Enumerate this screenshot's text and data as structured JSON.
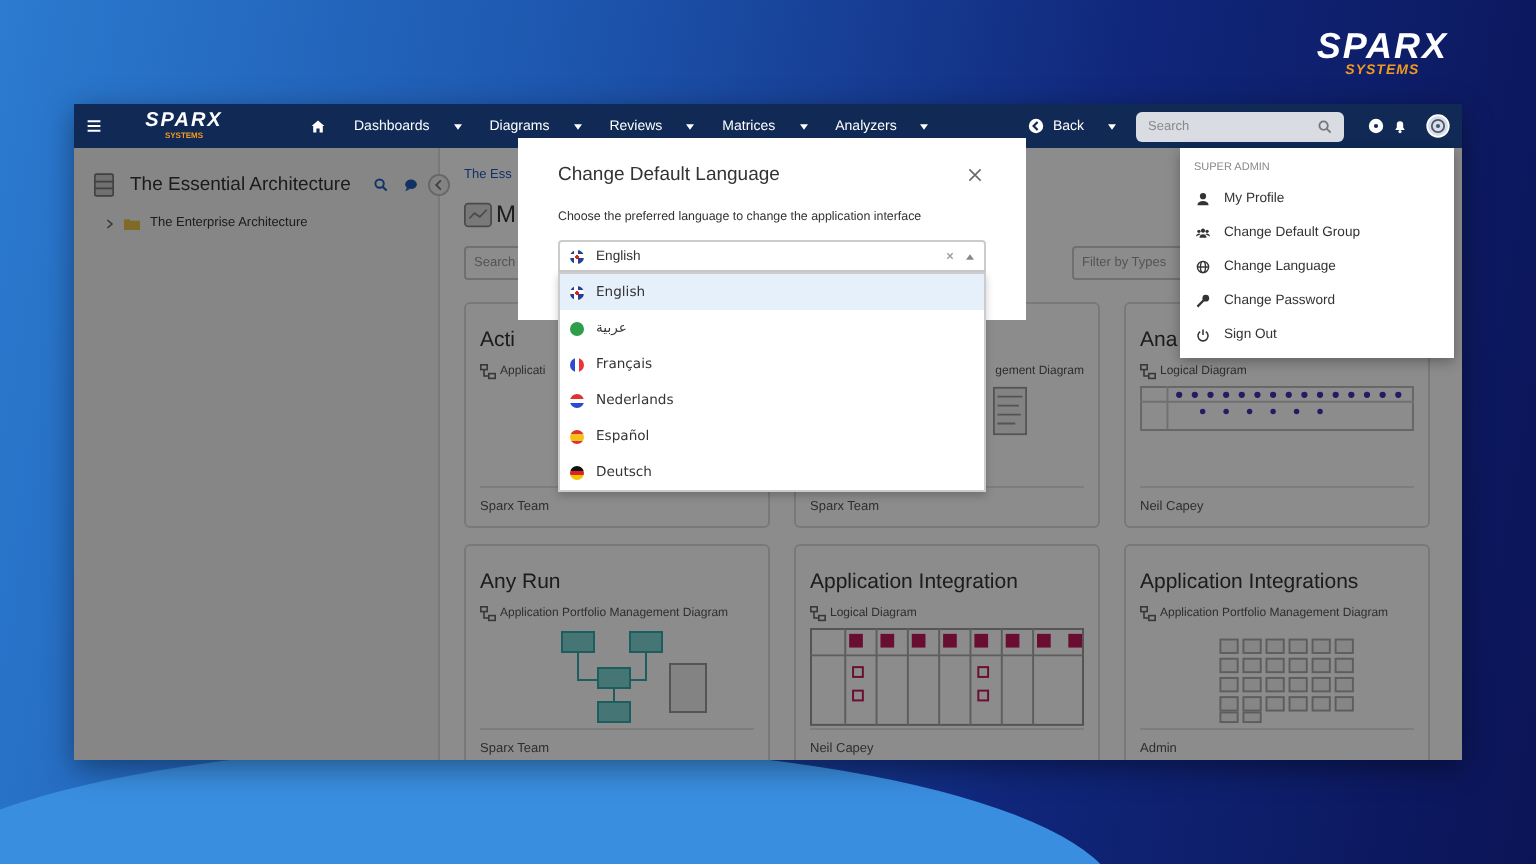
{
  "brand": {
    "name": "SPARX",
    "tagline": "SYSTEMS"
  },
  "navbar": {
    "logo": {
      "name": "SPARX",
      "tagline": "SYSTEMS"
    },
    "items": [
      {
        "label": "Dashboards"
      },
      {
        "label": "Diagrams"
      },
      {
        "label": "Reviews"
      },
      {
        "label": "Matrices"
      },
      {
        "label": "Analyzers"
      }
    ],
    "back": "Back",
    "search": {
      "placeholder": "Search"
    }
  },
  "sidebar": {
    "title": "The Essential Architecture",
    "tree": [
      {
        "label": "The Enterprise Architecture",
        "expanded": false
      }
    ]
  },
  "main": {
    "breadcrumb": "The Ess",
    "heading": "M",
    "search": {
      "placeholder": "Search"
    },
    "filter": {
      "placeholder": "Filter by Types"
    },
    "cards": [
      {
        "title": "Acti",
        "type": "Applicati",
        "author": "Sparx Team"
      },
      {
        "type": "gement Diagram",
        "author": "Sparx Team"
      },
      {
        "title": "Ana",
        "type": "Logical Diagram",
        "author": "Neil Capey"
      },
      {
        "title": "Any Run",
        "type": "Application Portfolio Management Diagram",
        "author": "Sparx Team"
      },
      {
        "title": "Application Integration",
        "type": "Logical Diagram",
        "author": "Neil Capey"
      },
      {
        "title": "Application Integrations",
        "type": "Application Portfolio Management Diagram",
        "author": "Admin"
      }
    ]
  },
  "dialog": {
    "title": "Change Default Language",
    "description": "Choose the preferred language to change the application interface",
    "select": {
      "value": "English"
    },
    "options": [
      {
        "label": "English",
        "selected": true
      },
      {
        "label": "عربية",
        "selected": false
      },
      {
        "label": "Français",
        "selected": false
      },
      {
        "label": "Nederlands",
        "selected": false
      },
      {
        "label": "Español",
        "selected": false
      },
      {
        "label": "Deutsch",
        "selected": false
      }
    ]
  },
  "user_menu": {
    "header": "SUPER ADMIN",
    "items": [
      {
        "label": "My Profile"
      },
      {
        "label": "Change Default Group"
      },
      {
        "label": "Change Language"
      },
      {
        "label": "Change Password"
      },
      {
        "label": "Sign Out"
      }
    ]
  }
}
